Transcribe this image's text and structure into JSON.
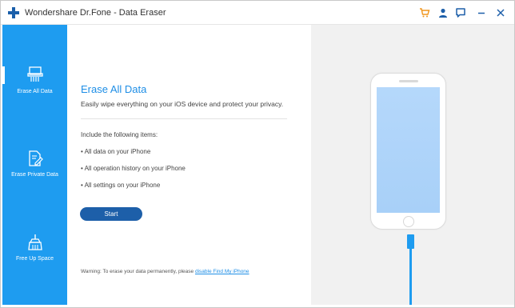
{
  "window": {
    "title": "Wondershare Dr.Fone - Data Eraser"
  },
  "titlebar": {
    "icons": [
      "cart-icon",
      "user-icon",
      "chat-icon",
      "minimize-icon",
      "close-icon"
    ]
  },
  "colors": {
    "sidebar": "#1e9cf0",
    "accent": "#1e8ee6",
    "button": "#1d5fa9",
    "phone_screen": "#b5d8fb",
    "right_panel": "#f1f1f1"
  },
  "sidebar": {
    "items": [
      {
        "label": "Erase All Data",
        "icon": "shredder-icon",
        "active": true
      },
      {
        "label": "Erase Private Data",
        "icon": "document-edit-icon",
        "active": false
      },
      {
        "label": "Free Up Space",
        "icon": "broom-icon",
        "active": false
      }
    ]
  },
  "main": {
    "heading": "Erase All Data",
    "subtitle": "Easily wipe everything on your iOS device and protect your privacy.",
    "include_title": "Include the following items:",
    "items": [
      "• All data on your iPhone",
      "• All operation history on your iPhone",
      "• All settings on your iPhone"
    ],
    "start_label": "Start",
    "warning_text": "Warning: To erase your data permanently, please ",
    "warning_link": "disable Find My iPhone"
  }
}
